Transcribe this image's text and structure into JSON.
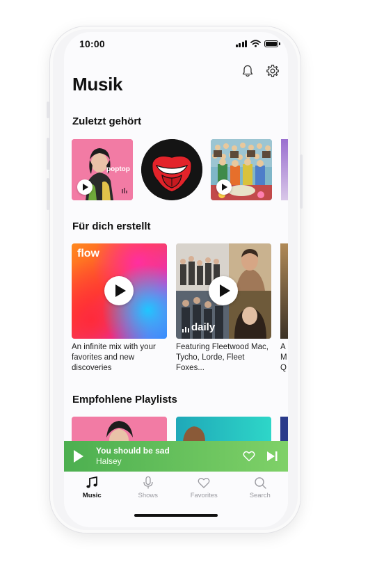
{
  "status_bar": {
    "time": "10:00"
  },
  "header": {
    "title": "Musik",
    "icons": [
      "bell-icon",
      "gear-icon"
    ]
  },
  "sections": {
    "recent": {
      "title": "Zuletzt gehört",
      "items": [
        {
          "name": "poptop",
          "badge": "poptop"
        },
        {
          "name": "rolling-stones"
        },
        {
          "name": "sgt-pepper"
        }
      ]
    },
    "for_you": {
      "title": "Für dich erstellt",
      "cards": [
        {
          "tag": "flow",
          "caption": "An infinite mix with your favorites and new discoveries"
        },
        {
          "tag": "daily",
          "caption": "Featuring Fleetwood Mac, Tycho, Lorde, Fleet Foxes..."
        },
        {
          "caption": "A M Q"
        }
      ]
    },
    "playlists": {
      "title": "Empfohlene Playlists"
    }
  },
  "now_playing": {
    "song": "You should be sad",
    "artist": "Halsey"
  },
  "tabs": [
    {
      "label": "Music",
      "icon": "music-note-icon",
      "active": true
    },
    {
      "label": "Shows",
      "icon": "microphone-icon",
      "active": false
    },
    {
      "label": "Favorites",
      "icon": "heart-icon",
      "active": false
    },
    {
      "label": "Search",
      "icon": "search-icon",
      "active": false
    }
  ],
  "colors": {
    "accent_green": "#4caf50",
    "accent_green_light": "#7fd168",
    "text": "#111111"
  }
}
